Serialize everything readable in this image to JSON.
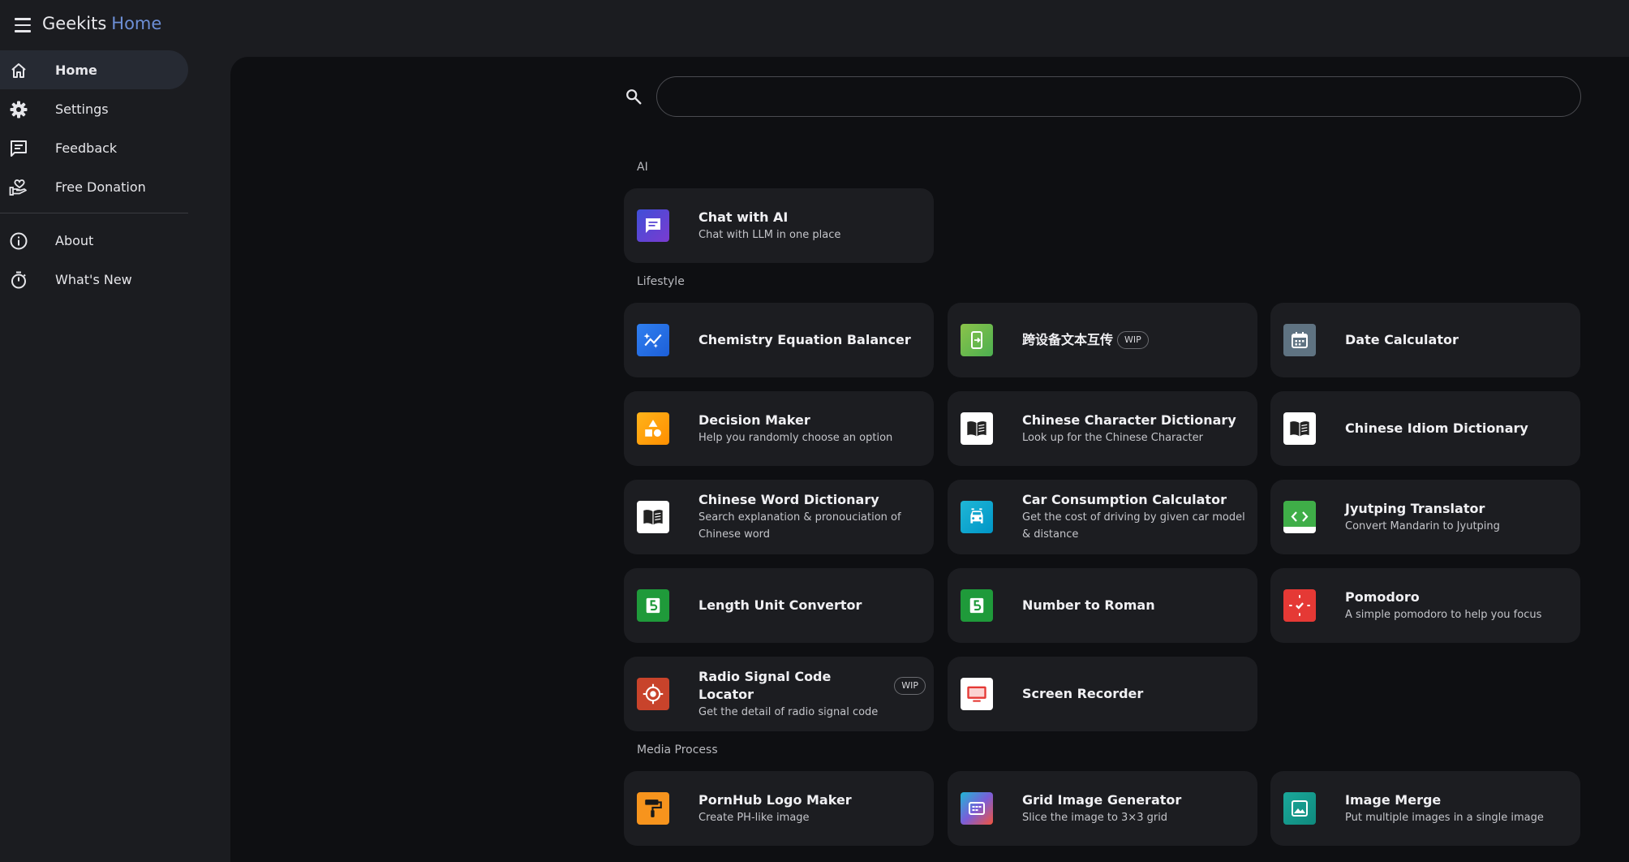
{
  "header": {
    "app_name": "Geekits",
    "page_name": "Home"
  },
  "sidebar": {
    "items": [
      {
        "label": "Home",
        "icon": "home-icon",
        "active": true
      },
      {
        "label": "Settings",
        "icon": "gear-icon"
      },
      {
        "label": "Feedback",
        "icon": "feedback-icon"
      },
      {
        "label": "Free Donation",
        "icon": "donation-icon"
      }
    ],
    "items_secondary": [
      {
        "label": "About",
        "icon": "info-icon"
      },
      {
        "label": "What's New",
        "icon": "timer-icon"
      }
    ]
  },
  "search": {
    "value": "",
    "placeholder": ""
  },
  "sections": [
    {
      "name": "AI"
    },
    {
      "name": "Lifestyle"
    },
    {
      "name": "Media Process"
    }
  ],
  "badge": "WIP",
  "tools": [
    {
      "title": "Chat with AI",
      "desc": "Chat with LLM in one place",
      "icon": "chat-icon"
    },
    {
      "title": "Chemistry Equation Balancer",
      "desc": "",
      "icon": "chemistry-icon"
    },
    {
      "title": "跨设备文本互传",
      "desc": "",
      "icon": "device-transfer-icon",
      "wip": true
    },
    {
      "title": "Date Calculator",
      "desc": "",
      "icon": "calendar-icon"
    },
    {
      "title": "Decision Maker",
      "desc": "Help you randomly choose an option",
      "icon": "shapes-icon"
    },
    {
      "title": "Chinese Character Dictionary",
      "desc": "Look up for the Chinese Character",
      "icon": "book-icon"
    },
    {
      "title": "Chinese Idiom Dictionary",
      "desc": "",
      "icon": "book-icon"
    },
    {
      "title": "Chinese Word Dictionary",
      "desc": "Search explanation & pronouciation of Chinese word",
      "icon": "book-icon"
    },
    {
      "title": "Car Consumption Calculator",
      "desc": "Get the cost of driving by given car model & distance",
      "icon": "car-icon"
    },
    {
      "title": "Jyutping Translator",
      "desc": "Convert Mandarin to Jyutping",
      "icon": "code-icon"
    },
    {
      "title": "Length Unit Convertor",
      "desc": "",
      "icon": "number-five-icon"
    },
    {
      "title": "Number to Roman",
      "desc": "",
      "icon": "number-five-icon"
    },
    {
      "title": "Pomodoro",
      "desc": "A simple pomodoro to help you focus",
      "icon": "pomodoro-icon"
    },
    {
      "title": "Radio Signal Code Locator",
      "desc": "Get the detail of radio signal code",
      "icon": "target-icon",
      "wip": true
    },
    {
      "title": "Screen Recorder",
      "desc": "",
      "icon": "screen-icon"
    },
    {
      "title": "PornHub Logo Maker",
      "desc": "Create PH-like image",
      "icon": "paint-roller-icon"
    },
    {
      "title": "Grid Image Generator",
      "desc": "Slice the image to 3×3 grid",
      "icon": "grid-image-icon"
    },
    {
      "title": "Image Merge",
      "desc": "Put multiple images in a single image",
      "icon": "image-icon"
    }
  ]
}
